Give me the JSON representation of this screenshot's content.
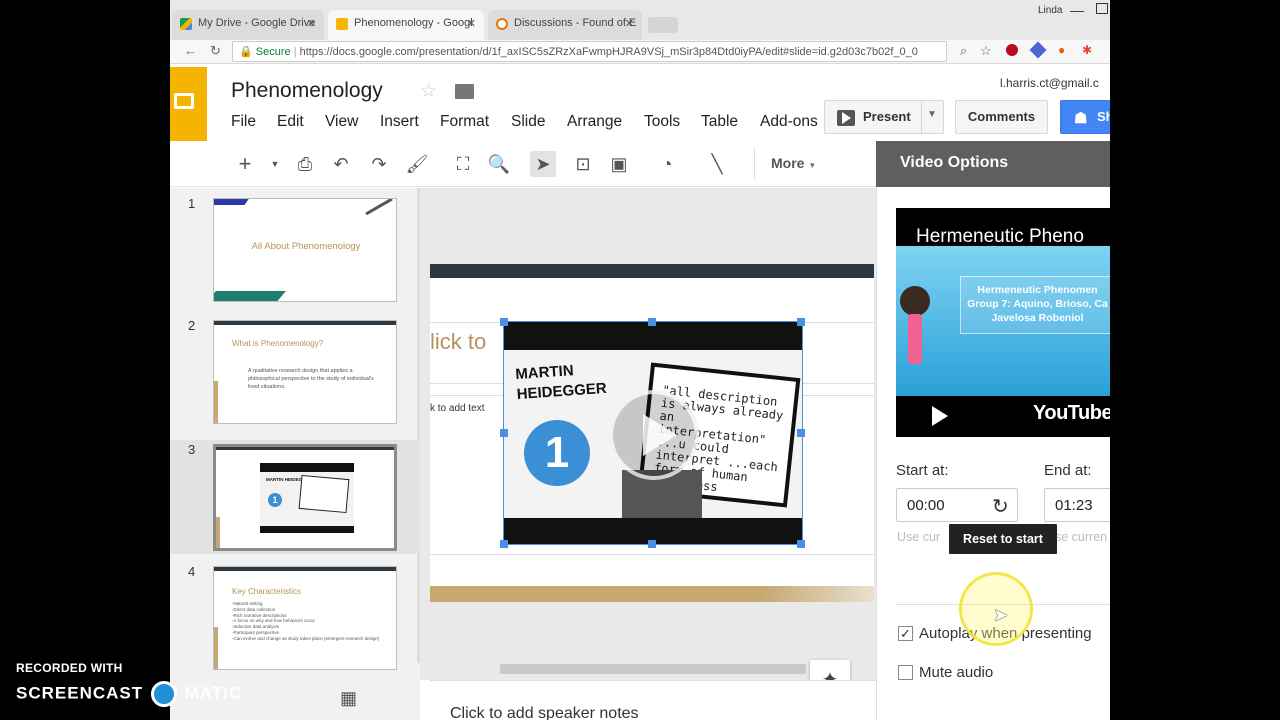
{
  "browser": {
    "tabs": [
      {
        "label": "My Drive - Google Drive"
      },
      {
        "label": "Phenomenology - Googl"
      },
      {
        "label": "Discussions - Found of E"
      }
    ],
    "profile_name": "Linda",
    "secure_label": "Secure",
    "url": "https://docs.google.com/presentation/d/1f_axISC5sZRzXaFwmpHJRA9VSj_mSir3p84Dtd0iyPA/edit#slide=id.g2d03c7b02f_0_0"
  },
  "doc": {
    "title": "Phenomenology",
    "account": "l.harris.ct@gmail.c",
    "menu": [
      "File",
      "Edit",
      "View",
      "Insert",
      "Format",
      "Slide",
      "Arrange",
      "Tools",
      "Table",
      "Add-ons"
    ],
    "present_label": "Present",
    "comments_label": "Comments",
    "share_label": "Sh"
  },
  "toolbar": {
    "more_label": "More"
  },
  "slides": [
    {
      "number": "1",
      "title": "All About Phenomenology"
    },
    {
      "number": "2",
      "title": "What is Phenomenology?",
      "body": "A qualitative research design that applies a philosophical perspective to the study of individual's lived situations."
    },
    {
      "number": "3",
      "title": "",
      "video_text": "MARTIN HEIDEGGER"
    },
    {
      "number": "4",
      "title": "Key Characteristics",
      "body": "-Natural setting\n-Direct data collection\n-Rich narrative descriptions\n-A focus on why and how behaviors occur\n-Inductive data analysis\n-Participant perspective\n-Can evolve and change as study takes place (emergent research design)"
    }
  ],
  "canvas": {
    "title_placeholder": "lick to",
    "body_placeholder": "k to add text",
    "video": {
      "name_line1": "MARTIN",
      "name_line2": "HEIDEGGER",
      "number": "1",
      "quote": "\"all description is always already an interpretation\" ...u could interpret ...each form of human awareness"
    }
  },
  "notes": {
    "placeholder": "Click to add speaker notes"
  },
  "video_options": {
    "heading": "Video Options",
    "preview_title": "Hermeneutic Pheno",
    "preview_sub1": "Hermeneutic Phenomen",
    "preview_sub2": "Group 7: Aquino, Brioso, Ca",
    "preview_sub3": "Javelosa Robeniol",
    "youtube_label": "YouTube",
    "start_label": "Start at:",
    "end_label": "End at:",
    "start_value": "00:00",
    "end_value": "01:23",
    "use_current_left": "Use cur",
    "use_current_right": "se curren",
    "tooltip": "Reset to start",
    "autoplay_label": "Autoplay when presenting",
    "autoplay_checked": "✓",
    "mute_label": "Mute audio"
  },
  "watermark": {
    "line1": "RECORDED WITH",
    "line2": "SCREENCAST",
    "line3": "MATIC"
  }
}
